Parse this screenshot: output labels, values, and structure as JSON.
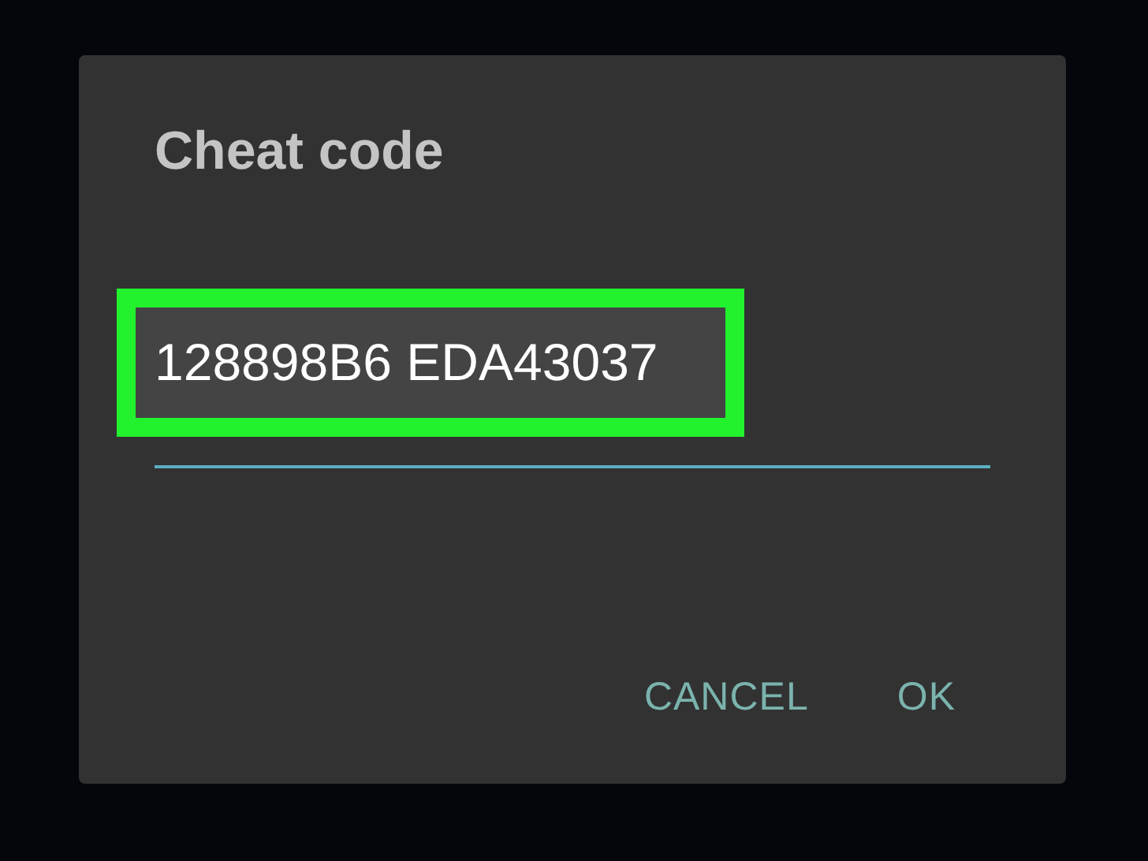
{
  "dialog": {
    "title": "Cheat code",
    "code_field": {
      "value": "128898B6 EDA43037",
      "highlighted": true
    },
    "buttons": [
      {
        "label": "CANCEL"
      },
      {
        "label": "OK"
      }
    ]
  }
}
